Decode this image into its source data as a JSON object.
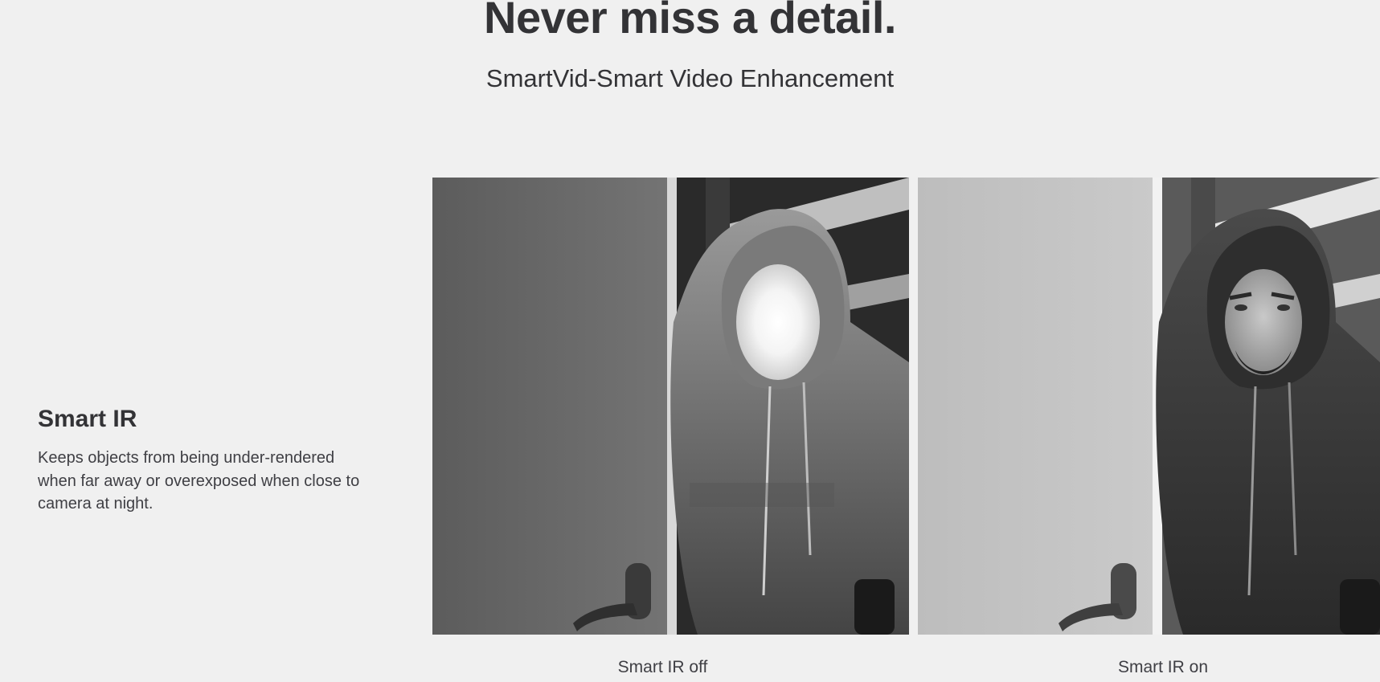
{
  "hero": {
    "title": "Never miss a detail.",
    "subtitle": "SmartVid-Smart Video Enhancement"
  },
  "feature": {
    "title": "Smart IR",
    "description": "Keeps objects from being under-rendered when far away or overexposed when close to camera at night."
  },
  "comparison": {
    "left_caption": "Smart IR off",
    "right_caption": "Smart IR on"
  },
  "colors": {
    "background": "#f0f0f0",
    "text": "#333336"
  }
}
